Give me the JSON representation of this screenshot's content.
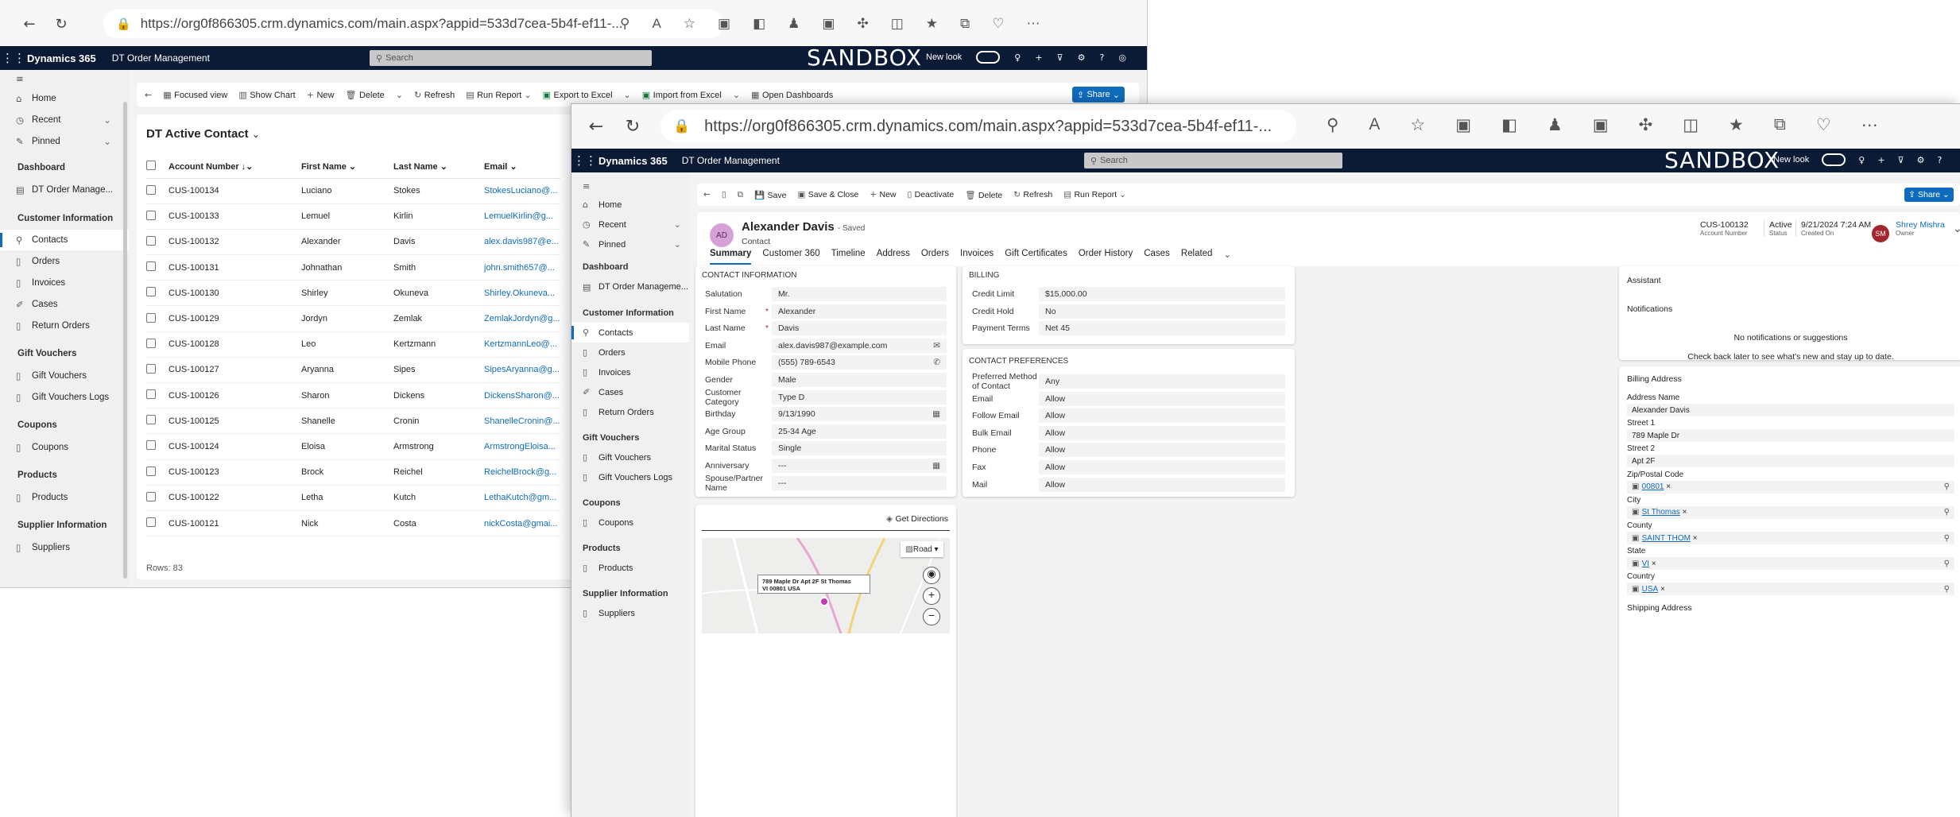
{
  "back_window": {
    "url": "https://org0f866305.crm.dynamics.com/main.aspx?appid=533d7cea-5b4f-ef11-...",
    "app_name": "Dynamics 365",
    "app_area": "DT Order Management",
    "search_placeholder": "Search",
    "sandbox": "SANDBOX",
    "new_look": "New look",
    "sidebar": {
      "home": "Home",
      "recent": "Recent",
      "pinned": "Pinned",
      "dashboard_group": "Dashboard",
      "dashboard_item": "DT Order Manage...",
      "customer_group": "Customer Information",
      "contacts": "Contacts",
      "orders": "Orders",
      "invoices": "Invoices",
      "cases": "Cases",
      "return_orders": "Return Orders",
      "gift_group": "Gift Vouchers",
      "gift_vouchers": "Gift Vouchers",
      "gift_logs": "Gift Vouchers Logs",
      "coupons_group": "Coupons",
      "coupons": "Coupons",
      "products_group": "Products",
      "products": "Products",
      "supplier_group": "Supplier Information",
      "suppliers": "Suppliers"
    },
    "commands": {
      "focused": "Focused view",
      "chart": "Show Chart",
      "new": "New",
      "delete": "Delete",
      "refresh": "Refresh",
      "report": "Run Report",
      "excel": "Export to Excel",
      "import": "Import from Excel",
      "dashboards": "Open Dashboards",
      "share": "Share"
    },
    "view_title": "DT Active Contact",
    "columns": {
      "account": "Account Number",
      "first": "First Name",
      "last": "Last Name",
      "email": "Email"
    },
    "rows": [
      {
        "acct": "CUS-100134",
        "first": "Luciano",
        "last": "Stokes",
        "email": "StokesLuciano@..."
      },
      {
        "acct": "CUS-100133",
        "first": "Lemuel",
        "last": "Kirlin",
        "email": "LemuelKirlin@g..."
      },
      {
        "acct": "CUS-100132",
        "first": "Alexander",
        "last": "Davis",
        "email": "alex.davis987@e..."
      },
      {
        "acct": "CUS-100131",
        "first": "Johnathan",
        "last": "Smith",
        "email": "john.smith657@..."
      },
      {
        "acct": "CUS-100130",
        "first": "Shirley",
        "last": "Okuneva",
        "email": "Shirley.Okuneva..."
      },
      {
        "acct": "CUS-100129",
        "first": "Jordyn",
        "last": "Zemlak",
        "email": "ZemlakJordyn@g..."
      },
      {
        "acct": "CUS-100128",
        "first": "Leo",
        "last": "Kertzmann",
        "email": "KertzmannLeo@..."
      },
      {
        "acct": "CUS-100127",
        "first": "Aryanna",
        "last": "Sipes",
        "email": "SipesAryanna@g..."
      },
      {
        "acct": "CUS-100126",
        "first": "Sharon",
        "last": "Dickens",
        "email": "DickensSharon@..."
      },
      {
        "acct": "CUS-100125",
        "first": "Shanelle",
        "last": "Cronin",
        "email": "ShanelleCronin@..."
      },
      {
        "acct": "CUS-100124",
        "first": "Eloisa",
        "last": "Armstrong",
        "email": "ArmstrongEloisa..."
      },
      {
        "acct": "CUS-100123",
        "first": "Brock",
        "last": "Reichel",
        "email": "ReichelBrock@g..."
      },
      {
        "acct": "CUS-100122",
        "first": "Letha",
        "last": "Kutch",
        "email": "LethaKutch@gm..."
      },
      {
        "acct": "CUS-100121",
        "first": "Nick",
        "last": "Costa",
        "email": "nickCosta@gmai..."
      }
    ],
    "rows_count": "Rows: 83"
  },
  "front_window": {
    "url": "https://org0f866305.crm.dynamics.com/main.aspx?appid=533d7cea-5b4f-ef11-...",
    "app_name": "Dynamics 365",
    "app_area": "DT Order Management",
    "search_placeholder": "Search",
    "sandbox": "SANDBOX",
    "new_look": "New look",
    "sidebar": {
      "home": "Home",
      "recent": "Recent",
      "pinned": "Pinned",
      "dashboard_group": "Dashboard",
      "dashboard_item": "DT Order Manageme...",
      "customer_group": "Customer Information",
      "contacts": "Contacts",
      "orders": "Orders",
      "invoices": "Invoices",
      "cases": "Cases",
      "return_orders": "Return Orders",
      "gift_group": "Gift Vouchers",
      "gift_vouchers": "Gift Vouchers",
      "gift_logs": "Gift Vouchers Logs",
      "coupons_group": "Coupons",
      "coupons": "Coupons",
      "products_group": "Products",
      "products": "Products",
      "supplier_group": "Supplier Information",
      "suppliers": "Suppliers"
    },
    "commands": {
      "save": "Save",
      "save_close": "Save & Close",
      "new": "New",
      "deactivate": "Deactivate",
      "delete": "Delete",
      "refresh": "Refresh",
      "report": "Run Report",
      "share": "Share"
    },
    "record": {
      "initials": "AD",
      "name": "Alexander Davis",
      "saved": "- Saved",
      "entity": "Contact",
      "account_number": "CUS-100132",
      "account_number_label": "Account Number",
      "status": "Active",
      "status_label": "Status",
      "created_on": "9/21/2024 7:24 AM",
      "created_on_label": "Created On",
      "owner_initials": "SM",
      "owner": "Shrey Mishra",
      "owner_label": "Owner"
    },
    "tabs": [
      "Summary",
      "Customer 360",
      "Timeline",
      "Address",
      "Orders",
      "Invoices",
      "Gift Certificates",
      "Order History",
      "Cases",
      "Related"
    ],
    "contact_info": {
      "title": "CONTACT INFORMATION",
      "fields": [
        {
          "label": "Salutation",
          "value": "Mr."
        },
        {
          "label": "First Name",
          "value": "Alexander"
        },
        {
          "label": "Last Name",
          "value": "Davis"
        },
        {
          "label": "Email",
          "value": "alex.davis987@example.com"
        },
        {
          "label": "Mobile Phone",
          "value": "(555) 789-6543"
        },
        {
          "label": "Gender",
          "value": "Male"
        },
        {
          "label": "Customer Category",
          "value": "Type D"
        },
        {
          "label": "Birthday",
          "value": "9/13/1990"
        },
        {
          "label": "Age Group",
          "value": "25-34 Age"
        },
        {
          "label": "Marital Status",
          "value": "Single"
        },
        {
          "label": "Anniversary",
          "value": "---"
        },
        {
          "label": "Spouse/Partner Name",
          "value": "---"
        }
      ]
    },
    "billing": {
      "title": "BILLING",
      "fields": [
        {
          "label": "Credit Limit",
          "value": "$15,000.00"
        },
        {
          "label": "Credit Hold",
          "value": "No"
        },
        {
          "label": "Payment Terms",
          "value": "Net 45"
        }
      ]
    },
    "preferences": {
      "title": "CONTACT PREFERENCES",
      "fields": [
        {
          "label": "Preferred Method of Contact",
          "value": "Any"
        },
        {
          "label": "Email",
          "value": "Allow"
        },
        {
          "label": "Follow Email",
          "value": "Allow"
        },
        {
          "label": "Bulk Email",
          "value": "Allow"
        },
        {
          "label": "Phone",
          "value": "Allow"
        },
        {
          "label": "Fax",
          "value": "Allow"
        },
        {
          "label": "Mail",
          "value": "Allow"
        }
      ]
    },
    "assistant": {
      "title": "Assistant",
      "notifications": "Notifications",
      "empty": "No notifications or suggestions",
      "hint": "Check back later to see what's new and stay up to date."
    },
    "billing_address": {
      "title": "Billing Address",
      "address_name_label": "Address Name",
      "address_name": "Alexander Davis",
      "street1_label": "Street 1",
      "street1": "789 Maple Dr",
      "street2_label": "Street 2",
      "street2": "Apt 2F",
      "zip_label": "Zip/Postal Code",
      "zip": "00801",
      "city_label": "City",
      "city": "St Thomas",
      "county_label": "County",
      "county": "SAINT THOM",
      "state_label": "State",
      "state": "VI",
      "country_label": "Country",
      "country": "USA",
      "shipping_label": "Shipping Address"
    },
    "map": {
      "directions": "Get Directions",
      "road": "Road",
      "pin_line1": "789 Maple Dr Apt 2F St Thomas",
      "pin_line2": "VI 00801 USA"
    }
  },
  "colors": {
    "nav": "#0b1a35",
    "accent": "#0f6cbd",
    "avatar": "#d6a0d6",
    "owner_avatar": "#a4262c"
  }
}
